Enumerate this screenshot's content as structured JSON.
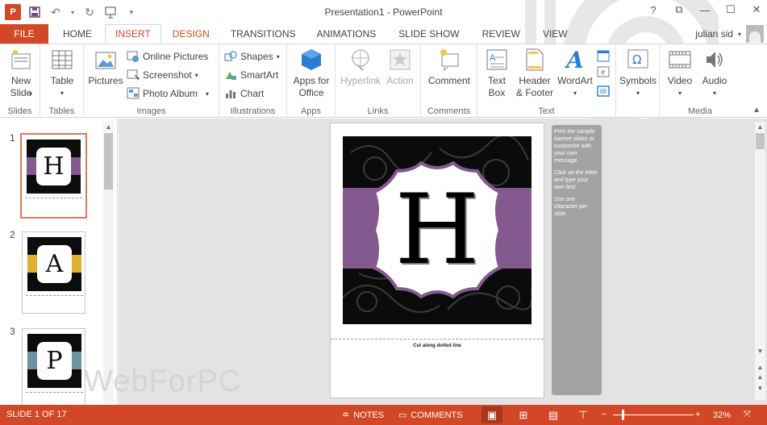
{
  "window": {
    "title": "Presentation1 - PowerPoint",
    "app_logo_text": "P",
    "controls": [
      "?",
      "restore",
      "minimize",
      "maximize",
      "close"
    ]
  },
  "user": {
    "name": "julian sid"
  },
  "tabs": [
    {
      "label": "FILE"
    },
    {
      "label": "HOME"
    },
    {
      "label": "INSERT",
      "active": true
    },
    {
      "label": "DESIGN"
    },
    {
      "label": "TRANSITIONS"
    },
    {
      "label": "ANIMATIONS"
    },
    {
      "label": "SLIDE SHOW"
    },
    {
      "label": "REVIEW"
    },
    {
      "label": "VIEW"
    }
  ],
  "ribbon": {
    "slides": {
      "label": "Slides",
      "new_slide": "New Slide"
    },
    "tables": {
      "label": "Tables",
      "table": "Table"
    },
    "images": {
      "label": "Images",
      "pictures": "Pictures",
      "online_pictures": "Online Pictures",
      "screenshot": "Screenshot",
      "photo_album": "Photo Album"
    },
    "illustrations": {
      "label": "Illustrations",
      "shapes": "Shapes",
      "smartart": "SmartArt",
      "chart": "Chart"
    },
    "apps": {
      "label": "Apps",
      "apps_for_office": "Apps for Office"
    },
    "links": {
      "label": "Links",
      "hyperlink": "Hyperlink",
      "action": "Action"
    },
    "comments": {
      "label": "Comments",
      "comment": "Comment"
    },
    "text": {
      "label": "Text",
      "text_box": "Text Box",
      "header_footer": "Header & Footer",
      "wordart": "WordArt"
    },
    "symbols": {
      "label": "",
      "symbols": "Symbols"
    },
    "media": {
      "label": "Media",
      "video": "Video",
      "audio": "Audio"
    }
  },
  "thumbnails": [
    {
      "number": "1",
      "letter": "H",
      "band_color": "#83598f",
      "selected": true
    },
    {
      "number": "2",
      "letter": "A",
      "band_color": "#e0b031",
      "selected": false
    },
    {
      "number": "3",
      "letter": "P",
      "band_color": "#6e93a3",
      "selected": false
    }
  ],
  "slide": {
    "letter": "H",
    "band_color": "#83598f",
    "cut_text": "Cut along dotted line",
    "notes": [
      "Print the sample banner slides or customize with your own message.",
      "Click on the letter and type your own text.",
      "Use one character per slide."
    ]
  },
  "watermark": "WebForPC",
  "status": {
    "slide_info": "SLIDE 1 OF 17",
    "notes": "NOTES",
    "comments": "COMMENTS",
    "zoom": "32%"
  },
  "colors": {
    "accent": "#d24726"
  }
}
